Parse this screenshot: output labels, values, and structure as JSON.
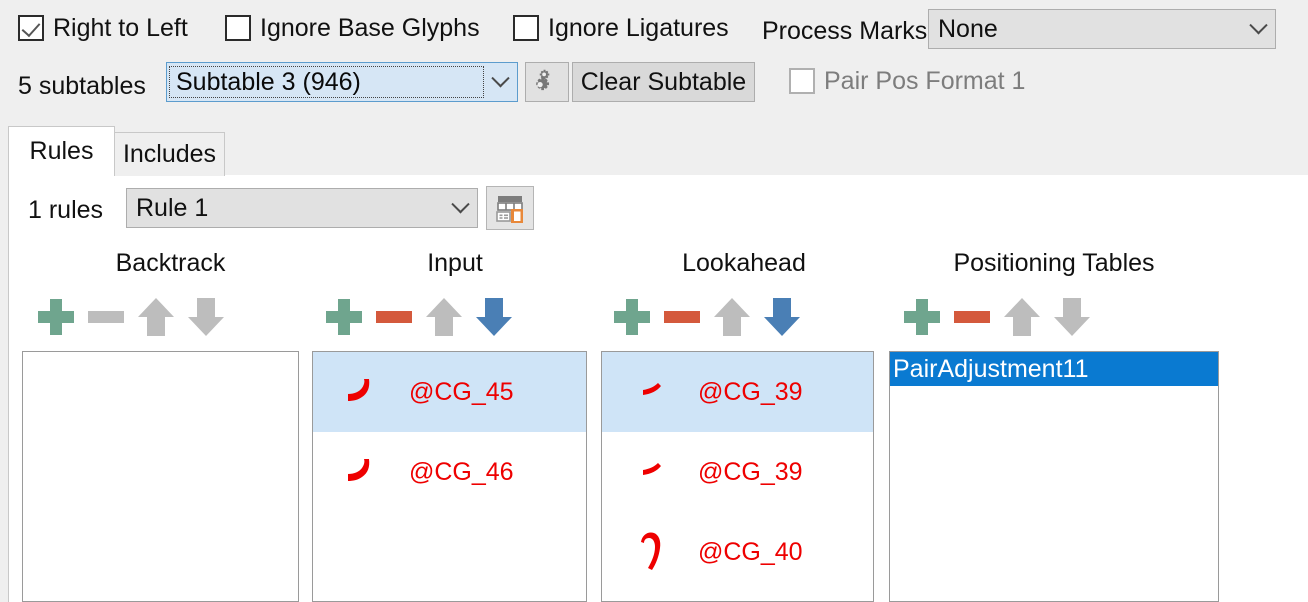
{
  "top_bar": {
    "checkboxes": [
      {
        "name": "right-to-left",
        "label": "Right to Left",
        "checked": true,
        "disabled": false
      },
      {
        "name": "ignore-base-glyphs",
        "label": "Ignore Base Glyphs",
        "checked": false,
        "disabled": false
      },
      {
        "name": "ignore-ligatures",
        "label": "Ignore Ligatures",
        "checked": false,
        "disabled": false
      }
    ],
    "process_marks": {
      "label": "Process Marks:",
      "value": "None",
      "chevron_icon": "chevron-down-icon"
    },
    "subtable_count": "5 subtables",
    "subtable_combo": {
      "value": "Subtable 3 (946)",
      "chevron_icon": "chevron-down-icon"
    },
    "gear_button": {
      "icon": "gears-icon"
    },
    "clear_subtable_button": "Clear Subtable",
    "pair_pos_format": {
      "label": "Pair Pos Format 1",
      "checked": false,
      "disabled": true
    }
  },
  "tabs": [
    {
      "name": "rules",
      "label": "Rules",
      "selected": true
    },
    {
      "name": "includes",
      "label": "Includes",
      "selected": false
    }
  ],
  "rules_panel": {
    "rules_count": "1 rules",
    "rule_combo": {
      "value": "Rule 1",
      "chevron_icon": "chevron-down-icon"
    },
    "rule_table_button": {
      "icon": "table-document-icon"
    },
    "columns": [
      {
        "name": "backtrack",
        "title": "Backtrack",
        "toolbar": [
          {
            "name": "add-backtrack-button",
            "icon": "plus-icon",
            "color": "#6fa58e",
            "enabled": true
          },
          {
            "name": "remove-backtrack-button",
            "icon": "minus-icon",
            "color": "#bdbdbd",
            "enabled": false
          },
          {
            "name": "move-backtrack-up-button",
            "icon": "arrow-up-icon",
            "color": "#bdbdbd",
            "enabled": false
          },
          {
            "name": "move-backtrack-down-button",
            "icon": "arrow-down-icon",
            "color": "#bdbdbd",
            "enabled": false
          }
        ],
        "items": []
      },
      {
        "name": "input",
        "title": "Input",
        "toolbar": [
          {
            "name": "add-input-button",
            "icon": "plus-icon",
            "color": "#6fa58e",
            "enabled": true
          },
          {
            "name": "remove-input-button",
            "icon": "minus-icon",
            "color": "#d4593c",
            "enabled": true
          },
          {
            "name": "move-input-up-button",
            "icon": "arrow-up-icon",
            "color": "#bdbdbd",
            "enabled": false
          },
          {
            "name": "move-input-down-button",
            "icon": "arrow-down-icon",
            "color": "#4a7fb5",
            "enabled": true
          }
        ],
        "items": [
          {
            "glyph": "arabic-reh-glyph",
            "label": "@CG_45",
            "selected": true
          },
          {
            "glyph": "arabic-reh-glyph",
            "label": "@CG_46",
            "selected": false
          }
        ]
      },
      {
        "name": "lookahead",
        "title": "Lookahead",
        "toolbar": [
          {
            "name": "add-lookahead-button",
            "icon": "plus-icon",
            "color": "#6fa58e",
            "enabled": true
          },
          {
            "name": "remove-lookahead-button",
            "icon": "minus-icon",
            "color": "#d4593c",
            "enabled": true
          },
          {
            "name": "move-lookahead-up-button",
            "icon": "arrow-up-icon",
            "color": "#bdbdbd",
            "enabled": false
          },
          {
            "name": "move-lookahead-down-button",
            "icon": "arrow-down-icon",
            "color": "#4a7fb5",
            "enabled": true
          }
        ],
        "items": [
          {
            "glyph": "arabic-dash-glyph",
            "label": "@CG_39",
            "selected": true
          },
          {
            "glyph": "arabic-dash-glyph",
            "label": "@CG_39",
            "selected": false
          },
          {
            "glyph": "arabic-hook-glyph",
            "label": "@CG_40",
            "selected": false
          }
        ]
      },
      {
        "name": "positioning-tables",
        "title": "Positioning Tables",
        "toolbar": [
          {
            "name": "add-positioning-button",
            "icon": "plus-icon",
            "color": "#6fa58e",
            "enabled": true
          },
          {
            "name": "remove-positioning-button",
            "icon": "minus-icon",
            "color": "#d4593c",
            "enabled": true
          },
          {
            "name": "move-positioning-up-button",
            "icon": "arrow-up-icon",
            "color": "#bdbdbd",
            "enabled": false
          },
          {
            "name": "move-positioning-down-button",
            "icon": "arrow-down-icon",
            "color": "#bdbdbd",
            "enabled": false
          }
        ],
        "items": [
          {
            "label": "PairAdjustment11",
            "selected": true
          }
        ]
      }
    ]
  },
  "colors": {
    "icon_green": "#6fa58e",
    "icon_red": "#d4593c",
    "icon_grey": "#bdbdbd",
    "icon_blue": "#4a7fb5",
    "glyph_red": "#ee0000",
    "selection_soft": "#cfe4f7",
    "selection_hard": "#0a7ad1",
    "window_bg": "#efefef"
  }
}
